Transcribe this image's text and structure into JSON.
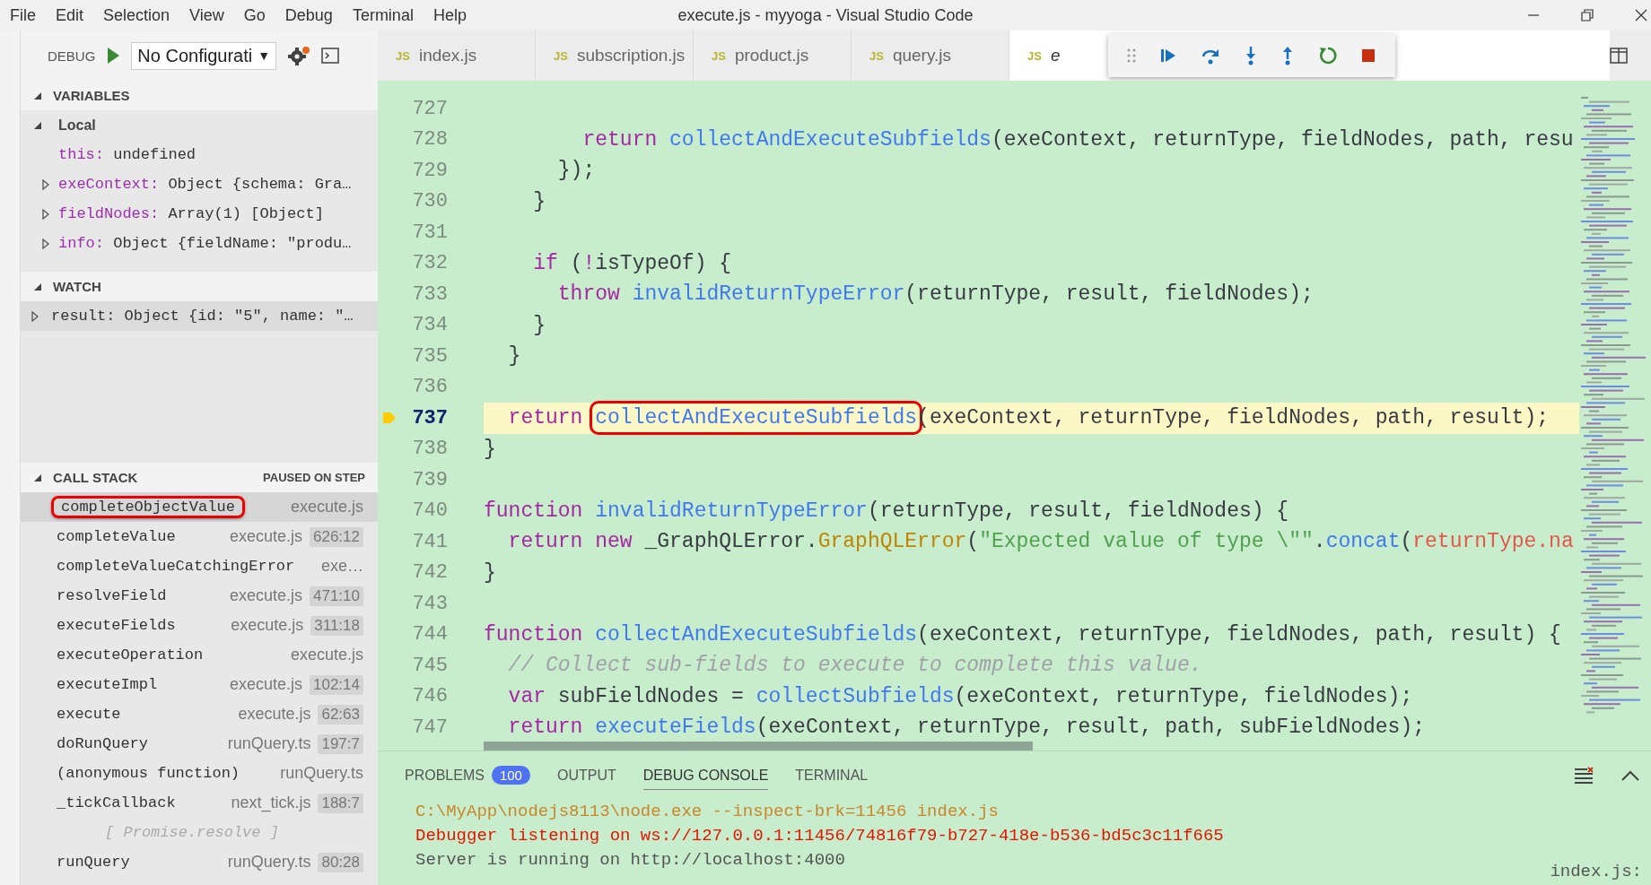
{
  "window": {
    "title": "execute.js - myyoga - Visual Studio Code"
  },
  "menu": [
    "File",
    "Edit",
    "Selection",
    "View",
    "Go",
    "Debug",
    "Terminal",
    "Help"
  ],
  "debug_bar": {
    "label": "DEBUG",
    "configuration": "No Configurati",
    "caret": "▼"
  },
  "tabs": [
    {
      "badge": "JS",
      "label": "index.js",
      "selected": false
    },
    {
      "badge": "JS",
      "label": "subscription.js",
      "selected": false
    },
    {
      "badge": "JS",
      "label": "product.js",
      "selected": false
    },
    {
      "badge": "JS",
      "label": "query.js",
      "selected": false
    },
    {
      "badge": "JS",
      "label": "e",
      "selected": true
    }
  ],
  "sidebar": {
    "variables": {
      "title": "VARIABLES",
      "expanded": true,
      "scopes": [
        {
          "name": "Local",
          "expanded": true,
          "children": [
            {
              "name": "this:",
              "value": "undefined",
              "expandable": false
            },
            {
              "name": "exeContext:",
              "value": "Object {schema: Gra…",
              "expandable": true
            },
            {
              "name": "fieldNodes:",
              "value": "Array(1) [Object]",
              "expandable": true
            },
            {
              "name": "info:",
              "value": "Object {fieldName: \"produ…",
              "expandable": true
            }
          ]
        }
      ]
    },
    "watch": {
      "title": "WATCH",
      "expanded": true,
      "items": [
        {
          "name": "result:",
          "value": "Object {id: \"5\", name: \"…",
          "expandable": true
        }
      ]
    },
    "call_stack": {
      "title": "CALL STACK",
      "status": "PAUSED ON STEP",
      "expanded": true,
      "frames": [
        {
          "kind": "frame",
          "name": "completeObjectValue",
          "file": "execute.js",
          "selected": true,
          "boxed": true
        },
        {
          "kind": "frame",
          "name": "completeValue",
          "file": "execute.js",
          "location": "626:12",
          "selected": false,
          "boxed": false
        },
        {
          "kind": "frame",
          "name": "completeValueCatchingError",
          "file": "exe…",
          "selected": false,
          "boxed": false
        },
        {
          "kind": "frame",
          "name": "resolveField",
          "file": "execute.js",
          "location": "471:10",
          "selected": false,
          "boxed": false
        },
        {
          "kind": "frame",
          "name": "executeFields",
          "file": "execute.js",
          "location": "311:18",
          "selected": false,
          "boxed": false
        },
        {
          "kind": "frame",
          "name": "executeOperation",
          "file": "execute.js",
          "selected": false,
          "boxed": false
        },
        {
          "kind": "frame",
          "name": "executeImpl",
          "file": "execute.js",
          "location": "102:14",
          "selected": false,
          "boxed": false
        },
        {
          "kind": "frame",
          "name": "execute",
          "file": "execute.js",
          "location": "62:63",
          "selected": false,
          "boxed": false
        },
        {
          "kind": "frame",
          "name": "doRunQuery",
          "file": "runQuery.ts",
          "location": "197:7",
          "selected": false,
          "boxed": false
        },
        {
          "kind": "frame",
          "name": "(anonymous function)",
          "file": "runQuery.ts",
          "selected": false,
          "boxed": false
        },
        {
          "kind": "frame",
          "name": "_tickCallback",
          "file": "next_tick.js",
          "location": "188:7",
          "selected": false,
          "boxed": false
        },
        {
          "kind": "label",
          "name": "[ Promise.resolve ]",
          "selected": false,
          "boxed": false
        },
        {
          "kind": "frame",
          "name": "runQuery",
          "file": "runQuery.ts",
          "location": "80:28",
          "selected": false,
          "boxed": false
        }
      ]
    }
  },
  "editor": {
    "lines": [
      {
        "number": "727",
        "current": false
      },
      {
        "number": "728",
        "current": false,
        "tokens": [
          {
            "kind": "keyword",
            "text": "        return "
          },
          {
            "kind": "function",
            "text": "collectAndExecuteSubfields"
          },
          {
            "kind": "plain",
            "text": "(exeContext, returnType, fieldNodes, path, resu"
          }
        ]
      },
      {
        "number": "729",
        "current": false,
        "tokens": [
          {
            "kind": "plain",
            "text": "      });"
          }
        ]
      },
      {
        "number": "730",
        "current": false,
        "tokens": [
          {
            "kind": "plain",
            "text": "    }"
          }
        ]
      },
      {
        "number": "731",
        "current": false
      },
      {
        "number": "732",
        "current": false,
        "tokens": [
          {
            "kind": "keyword",
            "text": "    if"
          },
          {
            "kind": "plain",
            "text": " ("
          },
          {
            "kind": "keyword",
            "text": "!"
          },
          {
            "kind": "plain",
            "text": "isTypeOf) {"
          }
        ]
      },
      {
        "number": "733",
        "current": false,
        "tokens": [
          {
            "kind": "keyword",
            "text": "      throw "
          },
          {
            "kind": "function",
            "text": "invalidReturnTypeError"
          },
          {
            "kind": "plain",
            "text": "(returnType, result, fieldNodes);"
          }
        ]
      },
      {
        "number": "734",
        "current": false,
        "tokens": [
          {
            "kind": "plain",
            "text": "    }"
          }
        ]
      },
      {
        "number": "735",
        "current": false,
        "tokens": [
          {
            "kind": "plain",
            "text": "  }"
          }
        ]
      },
      {
        "number": "736",
        "current": false
      },
      {
        "number": "737",
        "current": true,
        "tokens": [
          {
            "kind": "keyword",
            "text": "  return "
          },
          {
            "kind": "function",
            "text": "collectAndExecuteSubfields",
            "boxed": true
          },
          {
            "kind": "plain",
            "text": "(exeContext, returnType, fieldNodes, path, result);"
          }
        ]
      },
      {
        "number": "738",
        "current": false,
        "tokens": [
          {
            "kind": "plain",
            "text": "}"
          }
        ]
      },
      {
        "number": "739",
        "current": false
      },
      {
        "number": "740",
        "current": false,
        "tokens": [
          {
            "kind": "keyword",
            "text": "function "
          },
          {
            "kind": "function",
            "text": "invalidReturnTypeError"
          },
          {
            "kind": "plain",
            "text": "(returnType, result, fieldNodes) {"
          }
        ]
      },
      {
        "number": "741",
        "current": false,
        "tokens": [
          {
            "kind": "keyword",
            "text": "  return new"
          },
          {
            "kind": "plain",
            "text": " _GraphQLError."
          },
          {
            "kind": "class",
            "text": "GraphQLError"
          },
          {
            "kind": "plain",
            "text": "("
          },
          {
            "kind": "string",
            "text": "\"Expected value of type \\\"\""
          },
          {
            "kind": "plain",
            "text": "."
          },
          {
            "kind": "function",
            "text": "concat"
          },
          {
            "kind": "plain",
            "text": "("
          },
          {
            "kind": "variable",
            "text": "returnType.na"
          }
        ]
      },
      {
        "number": "742",
        "current": false,
        "tokens": [
          {
            "kind": "plain",
            "text": "}"
          }
        ]
      },
      {
        "number": "743",
        "current": false
      },
      {
        "number": "744",
        "current": false,
        "tokens": [
          {
            "kind": "keyword",
            "text": "function "
          },
          {
            "kind": "function",
            "text": "collectAndExecuteSubfields"
          },
          {
            "kind": "plain",
            "text": "(exeContext, returnType, fieldNodes, path, result) {"
          }
        ]
      },
      {
        "number": "745",
        "current": false,
        "tokens": [
          {
            "kind": "comment",
            "text": "  // Collect sub-fields to execute to complete this value."
          }
        ]
      },
      {
        "number": "746",
        "current": false,
        "tokens": [
          {
            "kind": "keyword",
            "text": "  var"
          },
          {
            "kind": "plain",
            "text": " subFieldNodes = "
          },
          {
            "kind": "function",
            "text": "collectSubfields"
          },
          {
            "kind": "plain",
            "text": "(exeContext, returnType, fieldNodes);"
          }
        ]
      },
      {
        "number": "747",
        "current": false,
        "tokens": [
          {
            "kind": "keyword",
            "text": "  return "
          },
          {
            "kind": "function",
            "text": "executeFields"
          },
          {
            "kind": "plain",
            "text": "(exeContext, returnType, result, path, subFieldNodes);"
          }
        ]
      }
    ]
  },
  "panel": {
    "tabs": [
      {
        "label": "PROBLEMS",
        "count": "100",
        "selected": false
      },
      {
        "label": "OUTPUT",
        "selected": false
      },
      {
        "label": "DEBUG CONSOLE",
        "selected": true
      },
      {
        "label": "TERMINAL",
        "selected": false
      }
    ],
    "console": [
      {
        "kind": "command",
        "text": "C:\\MyApp\\nodejs8113\\node.exe --inspect-brk=11456 index.js"
      },
      {
        "kind": "error",
        "text": "Debugger listening on ws://127.0.0.1:11456/74816f79-b727-418e-b536-bd5c3c11f665"
      },
      {
        "kind": "log",
        "text": "Server is running on http://localhost:4000"
      }
    ],
    "source_link": "index.js:"
  }
}
